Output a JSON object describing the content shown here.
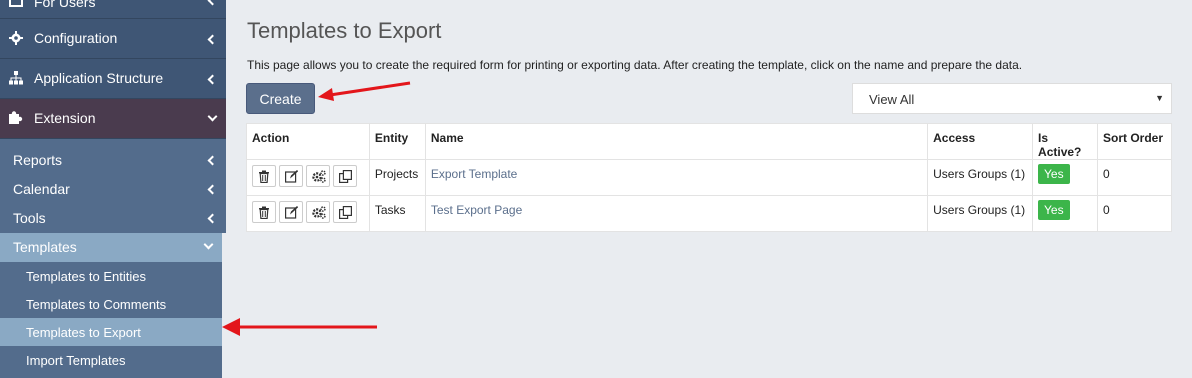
{
  "sidebar": {
    "top_item": "For Users",
    "main_items": [
      {
        "label": "Configuration"
      },
      {
        "label": "Application Structure"
      },
      {
        "label": "Extension"
      }
    ],
    "sub_items": [
      {
        "label": "Reports"
      },
      {
        "label": "Calendar"
      },
      {
        "label": "Tools"
      },
      {
        "label": "Templates"
      }
    ],
    "template_items": [
      {
        "label": "Templates to Entities"
      },
      {
        "label": "Templates to Comments"
      },
      {
        "label": "Templates to Export"
      },
      {
        "label": "Import Templates"
      }
    ]
  },
  "page": {
    "title": "Templates to Export",
    "description": "This page allows you to create the required form for printing or exporting data. After creating the template, click on the name and prepare the data.",
    "create_label": "Create",
    "filter_value": "View All"
  },
  "table": {
    "headers": [
      "Action",
      "Entity",
      "Name",
      "Access",
      "Is Active?",
      "Sort Order"
    ],
    "rows": [
      {
        "entity": "Projects",
        "name": "Export Template",
        "access": "Users Groups (1)",
        "active": "Yes",
        "sort": "0"
      },
      {
        "entity": "Tasks",
        "name": "Test Export Page",
        "access": "Users Groups (1)",
        "active": "Yes",
        "sort": "0"
      }
    ]
  },
  "colors": {
    "sidebar": "#536c8c",
    "active_item": "#8aa9c4",
    "create_button": "#5b6f8c",
    "yes_badge": "#3cb54a",
    "arrow": "#e3161b"
  }
}
